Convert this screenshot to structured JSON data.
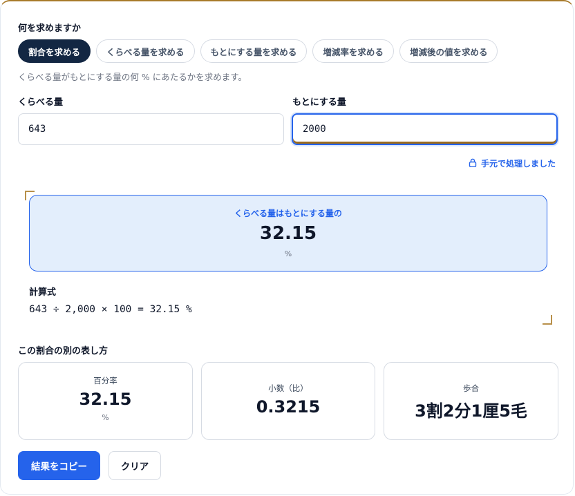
{
  "question": {
    "title": "何を求めますか",
    "modes": [
      {
        "label": "割合を求める",
        "active": true
      },
      {
        "label": "くらべる量を求める",
        "active": false
      },
      {
        "label": "もとにする量を求める",
        "active": false
      },
      {
        "label": "増減率を求める",
        "active": false
      },
      {
        "label": "増減後の値を求める",
        "active": false
      }
    ],
    "hint": "くらべる量がもとにする量の何 % にあたるかを求めます。"
  },
  "inputs": {
    "compare": {
      "label": "くらべる量",
      "value": "643"
    },
    "base": {
      "label": "もとにする量",
      "value": "2000"
    }
  },
  "local_note": "手元で処理しました",
  "result": {
    "caption": "くらべる量はもとにする量の",
    "value": "32.15",
    "unit": "%"
  },
  "formula": {
    "label": "計算式",
    "text": "643 ÷ 2,000 × 100 = 32.15 %"
  },
  "alternatives": {
    "title": "この割合の別の表し方",
    "items": [
      {
        "label": "百分率",
        "value": "32.15",
        "unit": "%"
      },
      {
        "label": "小数（比）",
        "value": "0.3215",
        "unit": ""
      },
      {
        "label": "歩合",
        "value": "3割2分1厘5毛",
        "unit": ""
      }
    ]
  },
  "actions": {
    "copy": "結果をコピー",
    "clear": "クリア"
  },
  "colors": {
    "accent": "#2563eb",
    "active_chip": "#132743",
    "result_bg": "#e3eefc",
    "gold": "#a87a2a"
  }
}
